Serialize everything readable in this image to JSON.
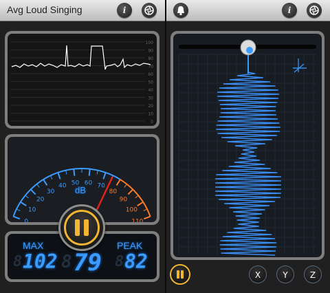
{
  "left": {
    "title": "Avg Loud Singing",
    "info_label": "i",
    "graph_scale": [
      "100",
      "90",
      "80",
      "70",
      "60",
      "50",
      "40",
      "30",
      "20",
      "10",
      "0"
    ],
    "meter_unit": "dB",
    "meter_ticks": [
      "0",
      "10",
      "20",
      "30",
      "40",
      "50",
      "60",
      "70",
      "80",
      "90",
      "100",
      "110"
    ],
    "meter_value_db": 75,
    "max_label": "MAX",
    "peak_label": "PEAK",
    "max_value": "102",
    "current_value": "79",
    "peak_value": "82",
    "pause_label": "pause"
  },
  "right": {
    "info_label": "i",
    "x_label": "X",
    "y_label": "Y",
    "z_label": "Z"
  },
  "colors": {
    "accent_blue": "#3a9cff",
    "meter_red_zone": "#ff7a2a",
    "pause_yellow": "#f2b632"
  }
}
